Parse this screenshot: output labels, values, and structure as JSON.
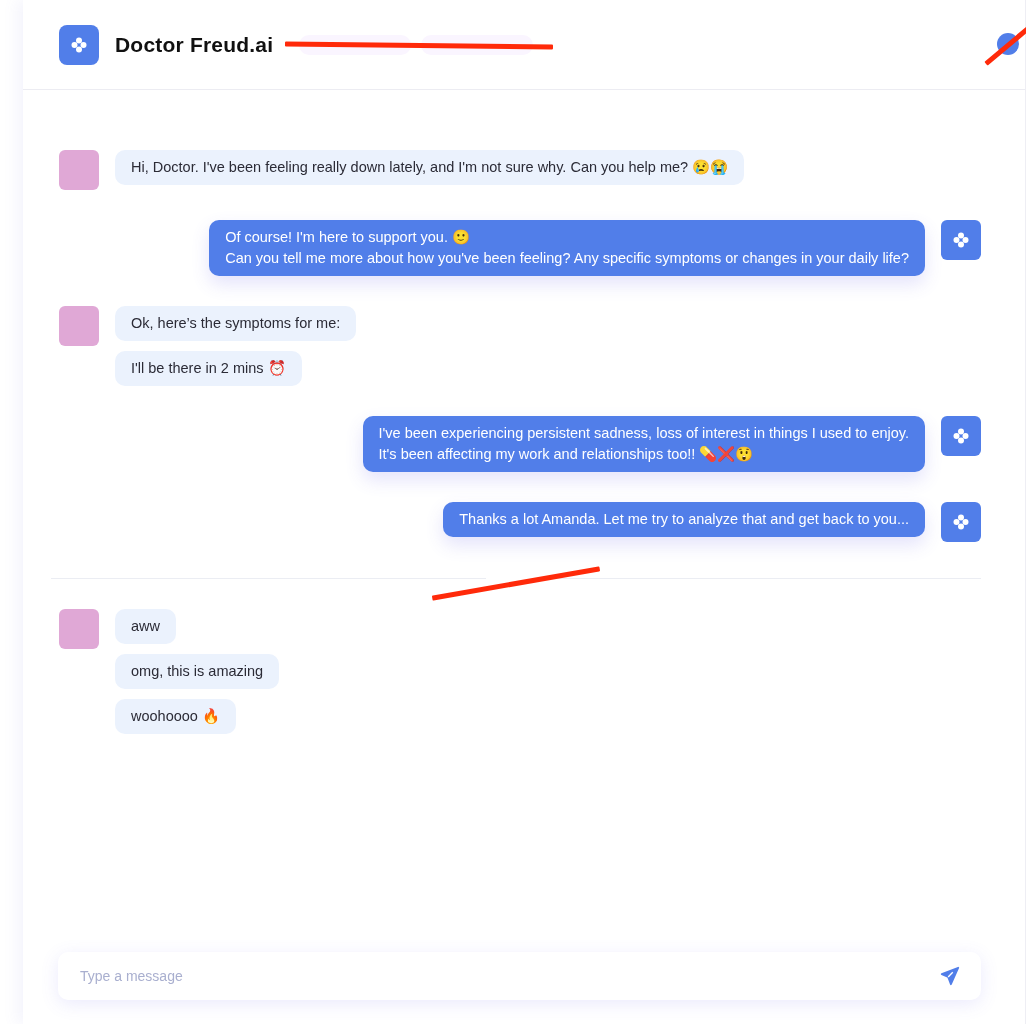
{
  "header": {
    "title": "Doctor Freud.ai",
    "badges_struck": true,
    "profile": {
      "struck": true
    }
  },
  "chat": [
    {
      "kind": "user",
      "messages": [
        "Hi, Doctor. I've been feeling really down lately, and I'm not sure why. Can you help me? 😢😭"
      ]
    },
    {
      "kind": "bot",
      "messages": [
        "Of course! I'm here to support you. 🙂\nCan you tell me more about how you've been feeling? Any specific symptoms or changes in your daily life?"
      ]
    },
    {
      "kind": "user",
      "messages": [
        "Ok, here’s the symptoms for me:",
        "I'll be there in 2 mins ⏰"
      ]
    },
    {
      "kind": "bot",
      "messages": [
        "I've been experiencing persistent sadness, loss of interest in things I used to enjoy.\nIt's been affecting my work and relationships too!! 💊❌😲"
      ]
    },
    {
      "kind": "bot",
      "messages": [
        "Thanks a lot Amanda. Let me try to analyze that and get back to you..."
      ]
    },
    {
      "kind": "divider",
      "struck": true
    },
    {
      "kind": "user",
      "messages": [
        "aww",
        "omg, this is amazing",
        "woohoooo 🔥"
      ]
    }
  ],
  "composer": {
    "placeholder": "Type a message"
  }
}
